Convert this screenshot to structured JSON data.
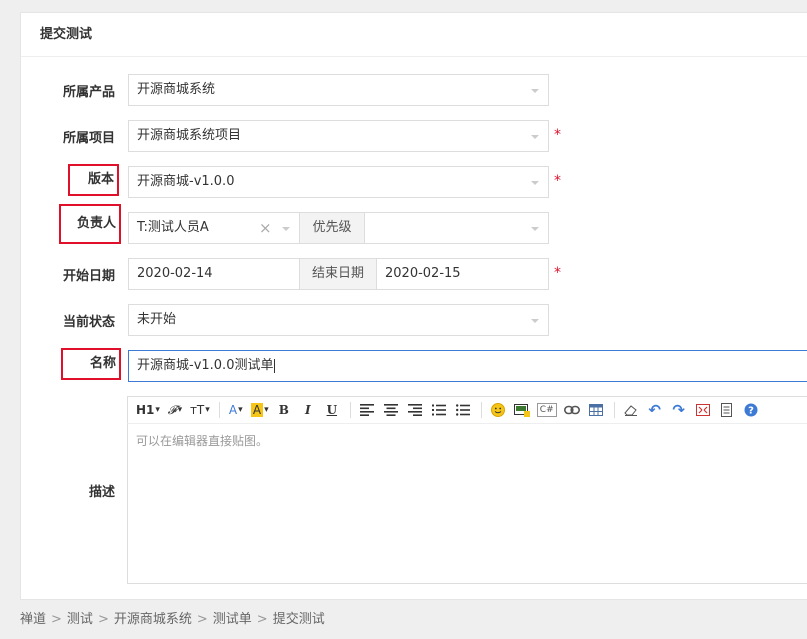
{
  "panel": {
    "title": "提交测试"
  },
  "form": {
    "product": {
      "label": "所属产品",
      "value": "开源商城系统"
    },
    "project": {
      "label": "所属项目",
      "value": "开源商城系统项目",
      "required": "*"
    },
    "build": {
      "label": "版本",
      "value": "开源商城-v1.0.0",
      "required": "*"
    },
    "owner": {
      "label": "负责人",
      "value": "T:测试人员A",
      "clear": "×",
      "priority_label": "优先级",
      "priority_value": ""
    },
    "dates": {
      "label": "开始日期",
      "begin": "2020-02-14",
      "end_label": "结束日期",
      "end": "2020-02-15",
      "required": "*"
    },
    "status": {
      "label": "当前状态",
      "value": "未开始"
    },
    "name": {
      "label": "名称",
      "value": "开源商城-v1.0.0测试单"
    },
    "desc": {
      "label": "描述",
      "placeholder": "可以在编辑器直接贴图。"
    }
  },
  "toolbar": {
    "heading": "H1",
    "font": "𝓕",
    "font_size": "тT",
    "font_color": "A",
    "bg_color": "A",
    "bold": "B",
    "italic": "I",
    "underline": "U",
    "code": "C#"
  },
  "breadcrumb": [
    "禅道",
    "测试",
    "开源商城系统",
    "测试单",
    "提交测试"
  ],
  "breadcrumb_sep": ">",
  "colors": {
    "required": "#e0102a",
    "highlight_box": "#e0102a",
    "focus_border": "#3d7ad6",
    "bg_color_btn": "#f5c518",
    "font_color_btn": "#3d7ad6"
  }
}
